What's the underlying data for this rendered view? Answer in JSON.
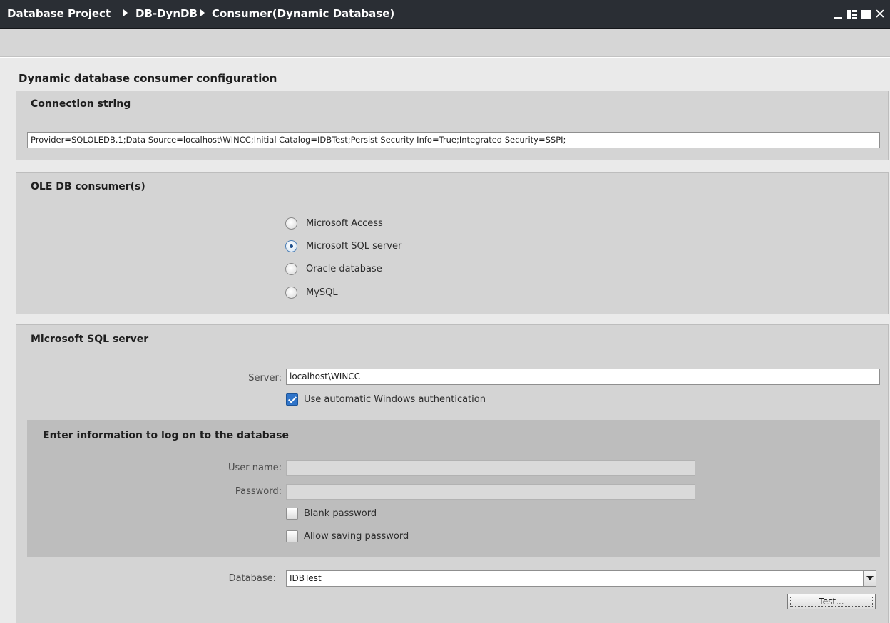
{
  "window": {
    "breadcrumb": [
      "Database Project",
      "DB-DynDB",
      "Consumer(Dynamic Database)"
    ],
    "controls": [
      "minimize-icon",
      "tile-icon",
      "maximize-icon",
      "close-icon"
    ],
    "close_glyph": "✕"
  },
  "page": {
    "title": "Dynamic database consumer configuration"
  },
  "connection": {
    "title": "Connection string",
    "value": "Provider=SQLOLEDB.1;Data Source=localhost\\WINCC;Initial Catalog=IDBTest;Persist Security Info=True;Integrated Security=SSPI;"
  },
  "ole": {
    "title": "OLE DB consumer(s)",
    "options": [
      {
        "label": "Microsoft Access",
        "checked": false
      },
      {
        "label": "Microsoft SQL server",
        "checked": true
      },
      {
        "label": "Oracle database",
        "checked": false
      },
      {
        "label": "MySQL",
        "checked": false
      }
    ]
  },
  "sql": {
    "title": "Microsoft SQL server",
    "server_label": "Server:",
    "server_value": "localhost\\WINCC",
    "auto_auth_label": "Use automatic Windows authentication",
    "auto_auth_checked": true,
    "logon": {
      "title": "Enter information to log on to the database",
      "user_label": "User name:",
      "user_value": "",
      "password_label": "Password:",
      "password_value": "",
      "blank_password_label": "Blank password",
      "allow_saving_label": "Allow saving password"
    },
    "database_label": "Database:",
    "database_value": "IDBTest",
    "test_button": "Test..."
  },
  "colors": {
    "titlebar": "#2a2e34",
    "section": "#d4d4d4",
    "inner_panel": "#bdbdbd",
    "accent": "#2f74c9"
  }
}
